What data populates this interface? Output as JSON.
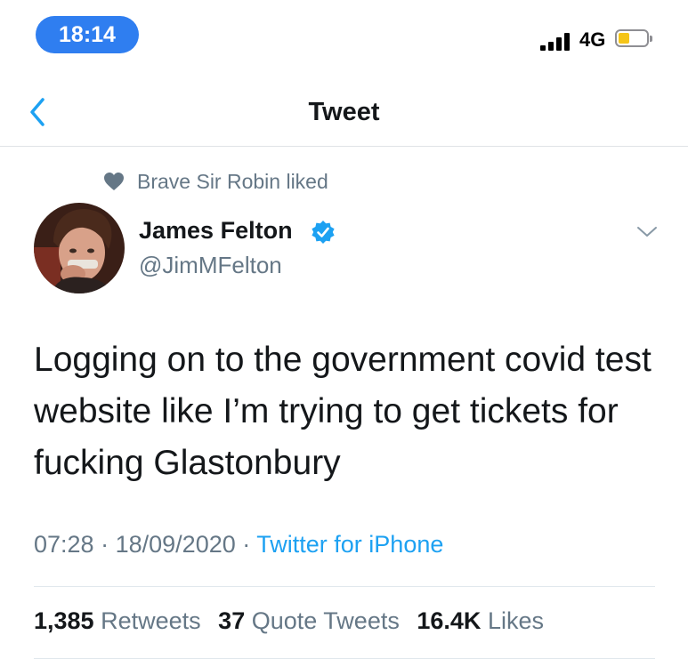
{
  "status_bar": {
    "time": "18:14",
    "network": "4G",
    "battery_level": 0.25,
    "colors": {
      "time_pill": "#2f7ef0",
      "battery_fill": "#f5c518"
    }
  },
  "nav": {
    "title": "Tweet",
    "back_icon": "chevron-left-icon"
  },
  "social_context": {
    "icon": "heart-icon",
    "text": "Brave Sir Robin liked"
  },
  "author": {
    "name": "James Felton",
    "handle": "@JimMFelton",
    "verified": true,
    "verified_icon": "verified-badge-icon"
  },
  "tweet": {
    "text": "Logging on to the government covid test website like I’m trying to get tickets for fucking Glastonbury",
    "time": "07:28",
    "date": "18/09/2020",
    "separator": "·",
    "source": "Twitter for iPhone"
  },
  "stats": {
    "retweets_count": "1,385",
    "retweets_label": "Retweets",
    "quotes_count": "37",
    "quotes_label": "Quote Tweets",
    "likes_count": "16.4K",
    "likes_label": "Likes"
  },
  "colors": {
    "accent": "#1da1f2",
    "secondary_text": "#657786",
    "primary_text": "#14171a"
  }
}
